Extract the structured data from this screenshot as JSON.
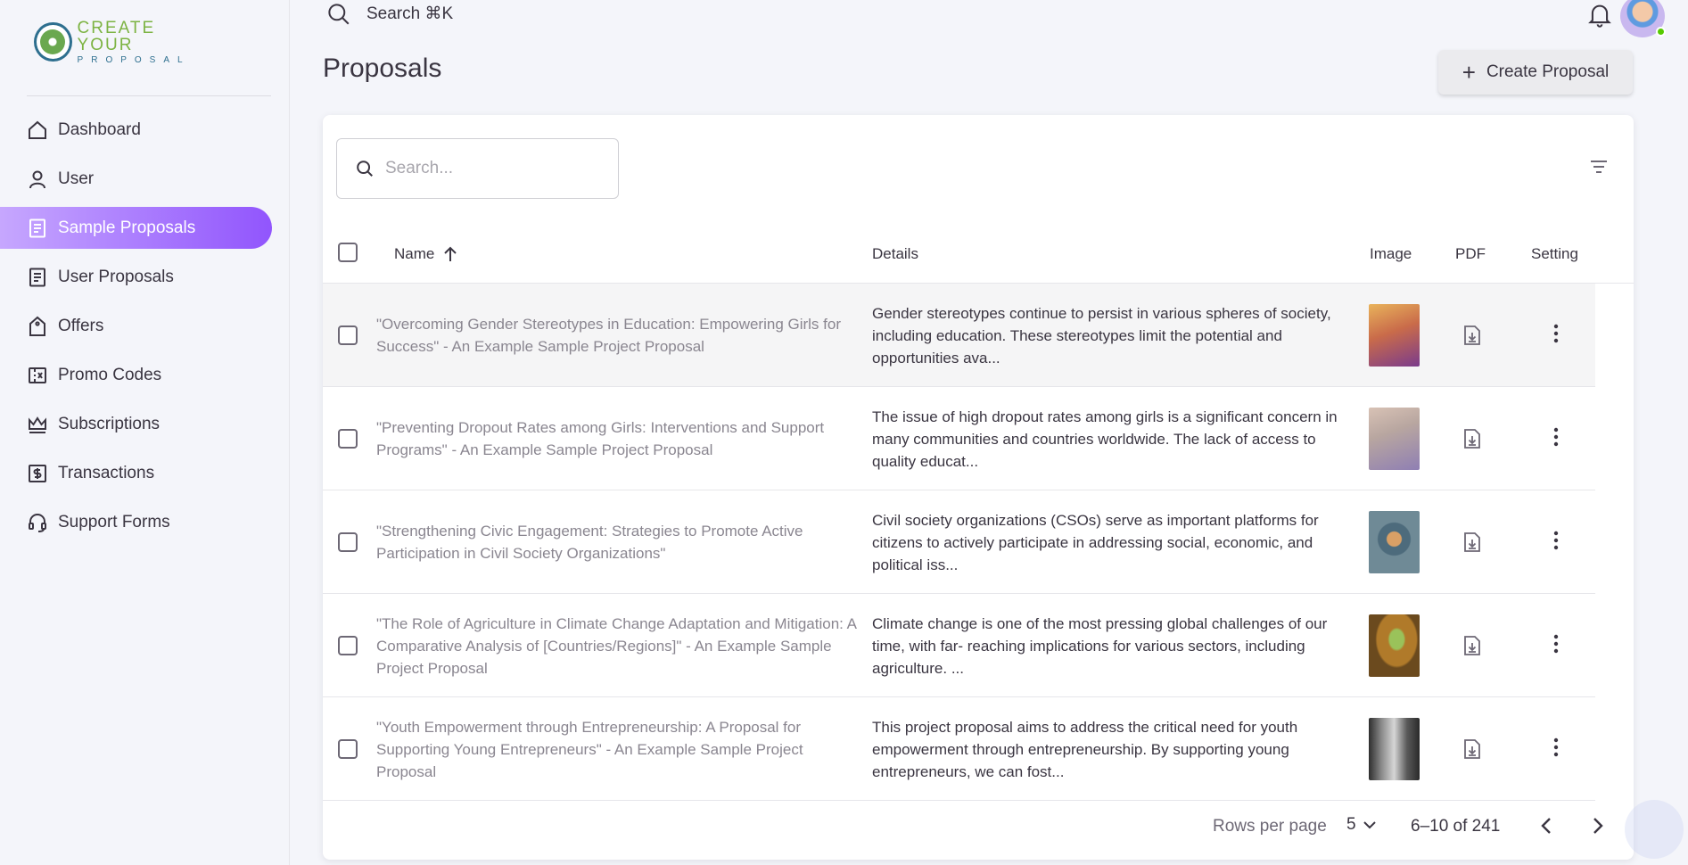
{
  "brand": {
    "line1": "CREATE YOUR",
    "line2": "PROPOSAL"
  },
  "sidebar": {
    "items": [
      {
        "label": "Dashboard",
        "icon": "home-icon",
        "active": false
      },
      {
        "label": "User",
        "icon": "user-icon",
        "active": false
      },
      {
        "label": "Sample Proposals",
        "icon": "document-icon",
        "active": true
      },
      {
        "label": "User Proposals",
        "icon": "document-icon",
        "active": false
      },
      {
        "label": "Offers",
        "icon": "tag-icon",
        "active": false
      },
      {
        "label": "Promo Codes",
        "icon": "ticket-icon",
        "active": false
      },
      {
        "label": "Subscriptions",
        "icon": "crown-icon",
        "active": false
      },
      {
        "label": "Transactions",
        "icon": "dollar-icon",
        "active": false
      },
      {
        "label": "Support Forms",
        "icon": "headset-icon",
        "active": false
      }
    ]
  },
  "header": {
    "search_label": "Search ⌘K",
    "page_title": "Proposals",
    "create_button": "Create Proposal"
  },
  "table": {
    "search_placeholder": "Search...",
    "columns": {
      "name": "Name",
      "details": "Details",
      "image": "Image",
      "pdf": "PDF",
      "setting": "Setting"
    },
    "rows": [
      {
        "name": "\"Overcoming Gender Stereotypes in Education: Empowering Girls for Success\" - An Example Sample Project Proposal",
        "details": "Gender stereotypes continue to persist in various spheres of society, including education. These stereotypes limit the potential and opportunities ava...",
        "thumb_color": "#c96b4a"
      },
      {
        "name": "\"Preventing Dropout Rates among Girls: Interventions and Support Programs\" - An Example Sample Project Proposal",
        "details": "The issue of high dropout rates among girls is a significant concern in many communities and countries worldwide. The lack of access to quality educat...",
        "thumb_color": "#b8a6a0"
      },
      {
        "name": "\"Strengthening Civic Engagement: Strategies to Promote Active Participation in Civil Society Organizations\"",
        "details": "Civil society organizations (CSOs) serve as important platforms for citizens to actively participate in addressing social, economic, and political iss...",
        "thumb_color": "#4d6b7c"
      },
      {
        "name": "\"The Role of Agriculture in Climate Change Adaptation and Mitigation: A Comparative Analysis of [Countries/Regions]\" - An Example Sample Project Proposal",
        "details": "Climate change is one of the most pressing global challenges of our time, with far- reaching implications for various sectors, including agriculture. ...",
        "thumb_color": "#b07a2a"
      },
      {
        "name": "\"Youth Empowerment through Entrepreneurship: A Proposal for Supporting Young Entrepreneurs\" - An Example Sample Project Proposal",
        "details": "This project proposal aims to address the critical need for youth empowerment through entrepreneurship. By supporting young entrepreneurs, we can fost...",
        "thumb_color": "#5a5a5a"
      }
    ]
  },
  "pagination": {
    "rows_per_page_label": "Rows per page",
    "rows_per_page": "5",
    "range": "6–10 of 241"
  }
}
